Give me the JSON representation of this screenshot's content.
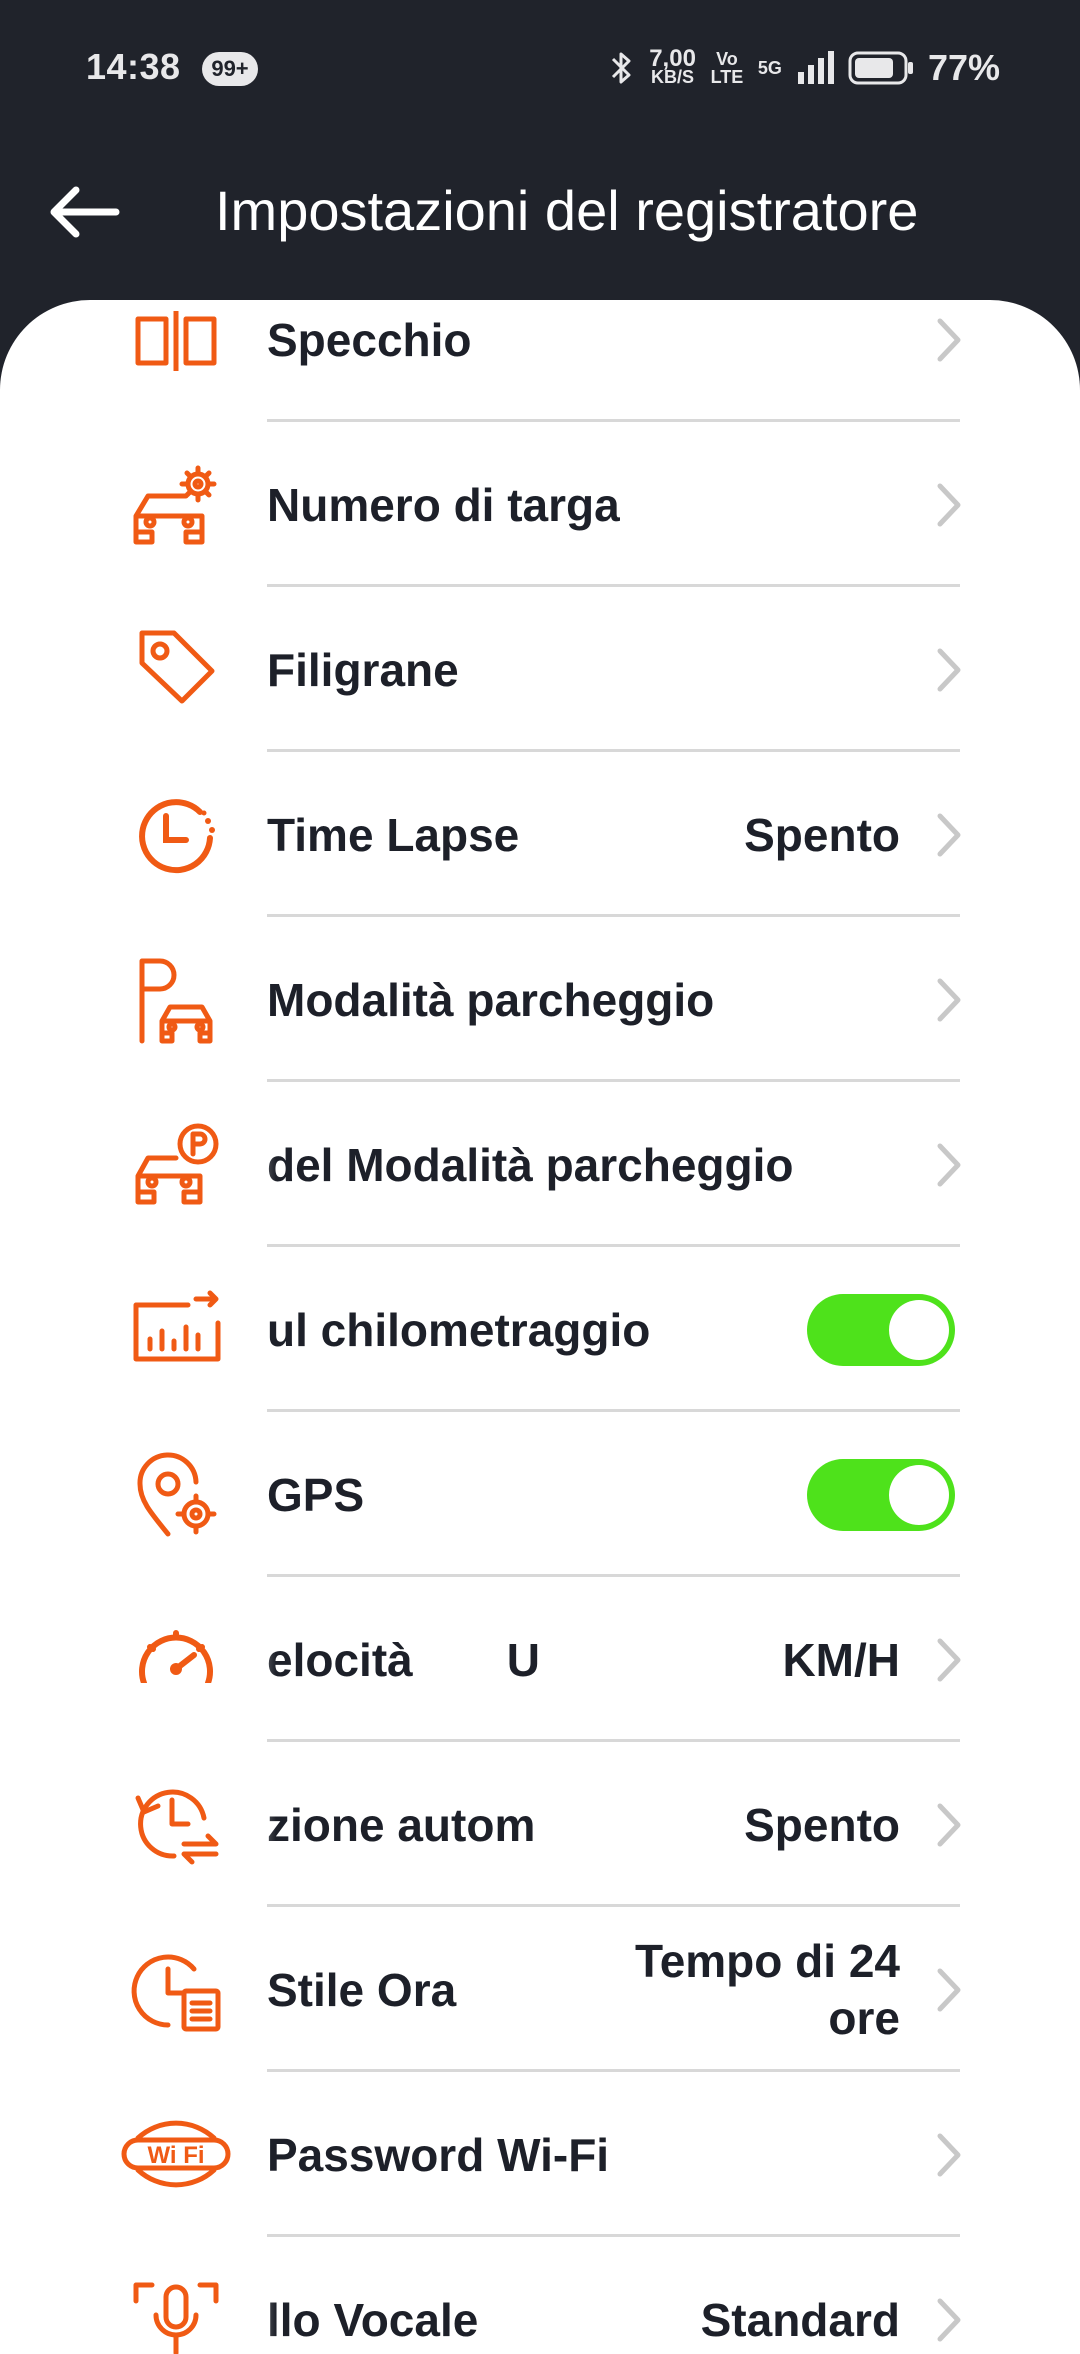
{
  "status_bar": {
    "time": "14:38",
    "notif_count": "99+",
    "net_speed": "7,00",
    "net_speed_unit": "KB/S",
    "volte": "Vo LTE",
    "network": "5G",
    "battery": "77%"
  },
  "header": {
    "title": "Impostazioni del registratore"
  },
  "colors": {
    "accent": "#f05a14",
    "toggle_on": "#4ee21b",
    "header_bg": "#20232b"
  },
  "settings": [
    {
      "label": "Specchio",
      "value": "",
      "icon": "mirror-icon",
      "control": "chevron"
    },
    {
      "label": "Numero di targa",
      "value": "",
      "icon": "car-settings-icon",
      "control": "chevron"
    },
    {
      "label": "Filigrane",
      "value": "",
      "icon": "tag-icon",
      "control": "chevron"
    },
    {
      "label": "Time Lapse",
      "value": "Spento",
      "icon": "timer-icon",
      "control": "chevron"
    },
    {
      "label": "Modalità parcheggio",
      "value": "",
      "icon": "parking-icon",
      "control": "chevron"
    },
    {
      "label": "del Modalità parcheggio",
      "value": "",
      "icon": "car-parking-icon",
      "control": "chevron"
    },
    {
      "label": "ul chilometraggio",
      "value": "",
      "icon": "mileage-chart-icon",
      "control": "toggle",
      "on": true
    },
    {
      "label": "GPS",
      "value": "",
      "icon": "gps-settings-icon",
      "control": "toggle",
      "on": true
    },
    {
      "label": "elocità",
      "label2": "U",
      "value": "KM/H",
      "icon": "speedometer-icon",
      "control": "chevron"
    },
    {
      "label": "zione autom",
      "value": "Spento",
      "icon": "clock-sync-icon",
      "control": "chevron"
    },
    {
      "label": "Stile Ora",
      "value": "Tempo di 24 ore",
      "icon": "clock-format-icon",
      "control": "chevron"
    },
    {
      "label": "Password Wi-Fi",
      "value": "",
      "icon": "wifi-icon",
      "control": "chevron"
    },
    {
      "label": "llo Vocale",
      "value": "Standard",
      "icon": "microphone-icon",
      "control": "chevron"
    }
  ]
}
